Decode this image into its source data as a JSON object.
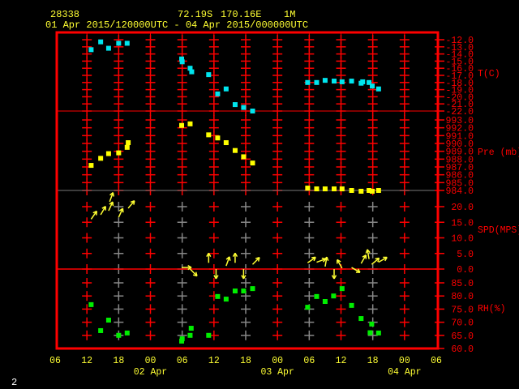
{
  "header": {
    "station": "28338",
    "lat": "72.19S",
    "lon": "170.16E",
    "height": "1M",
    "period": "01 Apr 2015/120000UTC - 04 Apr 2015/000000UTC"
  },
  "page_number": "2",
  "colors": {
    "frame": "#ff0000",
    "temp": "#00e5ee",
    "pressure": "#ffff00",
    "wind": "#ffff33",
    "rh": "#00ee00",
    "text": "#ffff33"
  },
  "chart_data": {
    "type": "scatter",
    "x_unit": "hours since 01 Apr 06 UTC",
    "xlim": [
      0,
      72
    ],
    "x_ticks": [
      "06",
      "12",
      "18",
      "00",
      "06",
      "12",
      "18",
      "00",
      "06",
      "12",
      "18",
      "00",
      "06"
    ],
    "date_labels": [
      {
        "label": "02 Apr",
        "hour": 18
      },
      {
        "label": "03 Apr",
        "hour": 42
      },
      {
        "label": "04 Apr",
        "hour": 66
      }
    ],
    "panels": [
      {
        "name": "temperature",
        "label": "T(C)",
        "ylim": [
          -22,
          -12
        ],
        "ticks": [
          "-12.0",
          "-13.0",
          "-14.0",
          "-15.0",
          "-16.0",
          "-17.0",
          "-18.0",
          "-19.0",
          "-20.0",
          "-21.0",
          "-22.0"
        ],
        "points": [
          [
            6.8,
            -13.4
          ],
          [
            8.6,
            -12.3
          ],
          [
            10.1,
            -13.2
          ],
          [
            12,
            -12.5
          ],
          [
            13.6,
            -12.5
          ],
          [
            23.9,
            -14.7
          ],
          [
            24,
            -15.1
          ],
          [
            25.5,
            -16.0
          ],
          [
            25.8,
            -16.5
          ],
          [
            29,
            -16.9
          ],
          [
            30.7,
            -19.6
          ],
          [
            32.3,
            -18.9
          ],
          [
            34,
            -21.1
          ],
          [
            35.6,
            -21.5
          ],
          [
            37.3,
            -22.0
          ],
          [
            47.7,
            -18.0
          ],
          [
            49.4,
            -18.0
          ],
          [
            51,
            -17.7
          ],
          [
            52.7,
            -17.8
          ],
          [
            54.2,
            -17.9
          ],
          [
            56,
            -17.8
          ],
          [
            57.8,
            -18.1
          ],
          [
            58.1,
            -17.9
          ],
          [
            59.3,
            -18.0
          ],
          [
            59.9,
            -18.5
          ],
          [
            61.1,
            -18.9
          ]
        ]
      },
      {
        "name": "pressure",
        "label": "Pre (mb)",
        "ylim": [
          984,
          993
        ],
        "ticks": [
          "993.0",
          "992.0",
          "991.0",
          "990.0",
          "989.0",
          "988.0",
          "987.0",
          "986.0",
          "985.0",
          "984.0"
        ],
        "points": [
          [
            6.8,
            987.2
          ],
          [
            8.6,
            988.1
          ],
          [
            10.1,
            988.7
          ],
          [
            12,
            988.8
          ],
          [
            13.6,
            989.5
          ],
          [
            13.8,
            990.1
          ],
          [
            23.9,
            992.3
          ],
          [
            25.5,
            992.5
          ],
          [
            29,
            991.1
          ],
          [
            30.7,
            990.7
          ],
          [
            32.3,
            990.1
          ],
          [
            34,
            989.1
          ],
          [
            35.6,
            988.3
          ],
          [
            37.3,
            987.5
          ],
          [
            47.7,
            984.3
          ],
          [
            49.4,
            984.2
          ],
          [
            51,
            984.2
          ],
          [
            52.7,
            984.2
          ],
          [
            54.2,
            984.2
          ],
          [
            56,
            984.0
          ],
          [
            57.8,
            983.9
          ],
          [
            59.3,
            984.0
          ],
          [
            59.9,
            983.9
          ],
          [
            61.1,
            984.0
          ]
        ]
      },
      {
        "name": "wind",
        "label": "SPD(MPS)",
        "ylim": [
          0,
          20
        ],
        "ticks": [
          "20.0",
          "15.0",
          "10.0",
          "5.0",
          "0.0"
        ],
        "arrows": [
          [
            6.8,
            16,
            35
          ],
          [
            8.6,
            17.4,
            30
          ],
          [
            10.1,
            18.7,
            25
          ],
          [
            10.3,
            21.6,
            20
          ],
          [
            12,
            16.6,
            25
          ],
          [
            13.8,
            19.5,
            40
          ],
          [
            23.9,
            0.5,
            90
          ],
          [
            25.5,
            0,
            135
          ],
          [
            29,
            2,
            0
          ],
          [
            30.4,
            0,
            180
          ],
          [
            32.3,
            1,
            20
          ],
          [
            34,
            2,
            0
          ],
          [
            35.6,
            0,
            180
          ],
          [
            37.3,
            1.5,
            45
          ],
          [
            47.7,
            2,
            55
          ],
          [
            49.4,
            2.2,
            70
          ],
          [
            51,
            0.8,
            10
          ],
          [
            52.7,
            0,
            180
          ],
          [
            54.2,
            0.3,
            330
          ],
          [
            56,
            0.5,
            120
          ],
          [
            57.8,
            1.8,
            30
          ],
          [
            59.3,
            3.2,
            350
          ],
          [
            59.8,
            1.5,
            50
          ],
          [
            61.1,
            2.2,
            60
          ]
        ]
      },
      {
        "name": "rh",
        "label": "RH(%)",
        "ylim": [
          60,
          85
        ],
        "ticks": [
          "85.0",
          "80.0",
          "75.0",
          "70.0",
          "65.0",
          "60.0"
        ],
        "points": [
          [
            6.8,
            76.7
          ],
          [
            8.6,
            66.8
          ],
          [
            10.1,
            70.8
          ],
          [
            12,
            65
          ],
          [
            13.6,
            65.9
          ],
          [
            23.9,
            62.8
          ],
          [
            24,
            63.7
          ],
          [
            25.5,
            65
          ],
          [
            25.7,
            67.7
          ],
          [
            29,
            65
          ],
          [
            30.7,
            79.8
          ],
          [
            32.3,
            78.8
          ],
          [
            34,
            81.9
          ],
          [
            35.6,
            81.9
          ],
          [
            37.3,
            82.8
          ],
          [
            47.7,
            75.7
          ],
          [
            49.4,
            79.8
          ],
          [
            51,
            77.9
          ],
          [
            52.6,
            80
          ],
          [
            54.2,
            82.8
          ],
          [
            56,
            76.4
          ],
          [
            57.8,
            71.4
          ],
          [
            59.5,
            66
          ],
          [
            59.8,
            69.3
          ],
          [
            61.1,
            65.9
          ]
        ]
      }
    ]
  }
}
